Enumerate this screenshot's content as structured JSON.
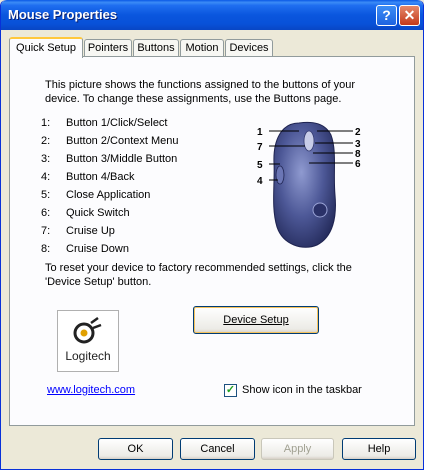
{
  "window": {
    "title": "Mouse Properties",
    "help_symbol": "?",
    "close_symbol": "✕"
  },
  "tabs": [
    {
      "label": "Quick Setup",
      "active": true
    },
    {
      "label": "Pointers",
      "active": false
    },
    {
      "label": "Buttons",
      "active": false
    },
    {
      "label": "Motion",
      "active": false
    },
    {
      "label": "Devices",
      "active": false
    }
  ],
  "quick_setup": {
    "intro": "This picture shows the functions assigned to the buttons of your device.  To change these assignments, use the Buttons page.",
    "functions": [
      {
        "num": "1:",
        "label": "Button 1/Click/Select"
      },
      {
        "num": "2:",
        "label": "Button 2/Context Menu"
      },
      {
        "num": "3:",
        "label": "Button 3/Middle Button"
      },
      {
        "num": "4:",
        "label": "Button 4/Back"
      },
      {
        "num": "5:",
        "label": "Close Application"
      },
      {
        "num": "6:",
        "label": "Quick Switch"
      },
      {
        "num": "7:",
        "label": "Cruise Up"
      },
      {
        "num": "8:",
        "label": "Cruise Down"
      }
    ],
    "mouse_callouts": [
      "1",
      "7",
      "5",
      "4",
      "2",
      "3",
      "8",
      "6"
    ],
    "reset_text": "To reset your device to factory recommended settings, click the 'Device Setup' button.",
    "device_setup_label": "Device Setup",
    "logo_text": "Logitech",
    "link_text": "www.logitech.com",
    "show_icon_label": "Show icon in the taskbar",
    "show_icon_checked": true
  },
  "footer": {
    "ok": "OK",
    "cancel": "Cancel",
    "apply": "Apply",
    "help": "Help"
  },
  "colors": {
    "titlebar": "#0a56de",
    "face": "#ece9d8",
    "tab_highlight": "#ffc83c",
    "mouse_body": "#3b4680"
  }
}
